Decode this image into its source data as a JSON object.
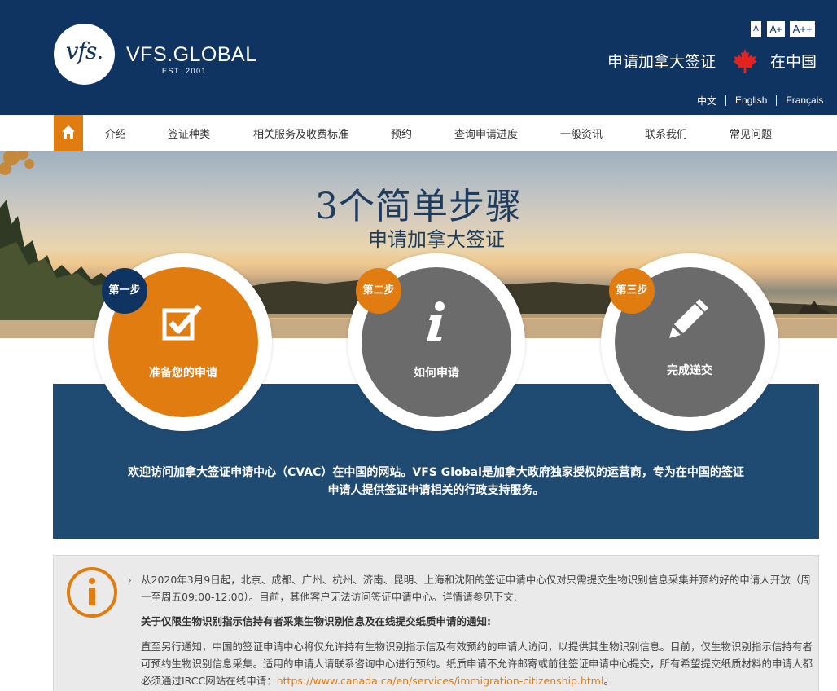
{
  "header": {
    "logo_mark": "vfs.",
    "logo_name": "VFS.GLOBAL",
    "logo_est": "EST. 2001",
    "font_sizes": [
      "A",
      "A+",
      "A++"
    ],
    "title": "申请加拿大签证",
    "country": "在中国",
    "languages": [
      "中文",
      "English",
      "Français"
    ]
  },
  "nav": {
    "items": [
      "介绍",
      "签证种类",
      "相关服务及收费标准",
      "预约",
      "查询申请进度",
      "一般资讯",
      "联系我们",
      "常见问题"
    ]
  },
  "hero": {
    "heading_num": "3",
    "heading_rest": "个简单步骤",
    "subheading": "申请加拿大签证"
  },
  "steps": [
    {
      "badge": "第一步",
      "label": "准备您的申请",
      "icon": "checkbox-icon"
    },
    {
      "badge": "第二步",
      "label": "如何申请",
      "icon": "info-icon"
    },
    {
      "badge": "第三步",
      "label": "完成递交",
      "icon": "pencil-icon"
    }
  ],
  "welcome": {
    "line1": "欢迎访问加拿大签证申请中心（CVAC）在中国的网站。VFS Global是加拿大政府独家授权的运营商，专为在中国的签证",
    "line2": "申请人提供签证申请相关的行政支持服务。"
  },
  "notice": {
    "p1": "从2020年3月9日起，北京、成都、广州、杭州、济南、昆明、上海和沈阳的签证申请中心仅对只需提交生物识别信息采集并预约好的申请人开放（周一至周五09:00-12:00）。目前，其他客户无法访问签证申请中心。详情请参见下文:",
    "p2": "关于仅限生物识别指示信持有者采集生物识别信息及在线提交纸质申请的通知:",
    "p3": "直至另行通知，中国的签证申请中心将仅允许持有生物识别指示信及有效预约的申请人访问，以提供其生物识别信息。目前，仅生物识别指示信持有者可预约生物识别信息采集。适用的申请人请联系咨询中心进行预约。纸质申请不允许邮寄或前往签证申请中心提交，所有希望提交纸质材料的申请人都必须通过IRCC网站在线申请：",
    "link": "https://www.canada.ca/en/services/immigration-citizenship.html",
    "p3_end": "。"
  },
  "colors": {
    "navy": "#0f3461",
    "orange": "#e07c10",
    "band_blue": "#1f4a72",
    "step_gray": "#6b6b6b",
    "badge_navy": "#0f3461"
  }
}
